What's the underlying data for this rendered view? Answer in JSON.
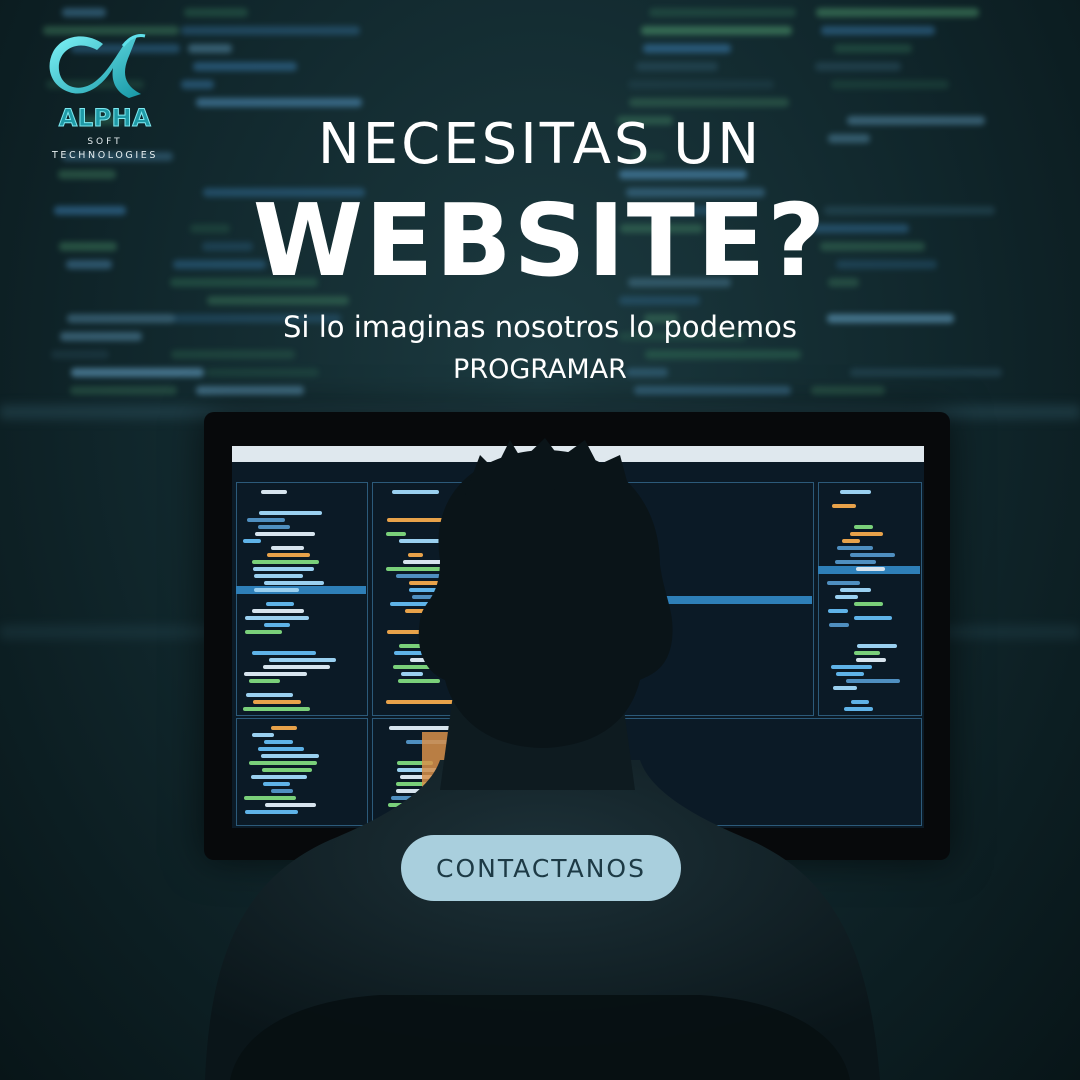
{
  "brand": {
    "name": "ALPHA",
    "tagline_line1": "SOFT",
    "tagline_line2": "TECHNOLOGIES",
    "icon": "alpha-symbol-icon",
    "accent_color": "#22b8c6"
  },
  "headline": {
    "line1": "NECESITAS UN",
    "line2": "WEBSITE?"
  },
  "subheadline": {
    "line1": "Si lo imaginas nosotros lo podemos",
    "line2": "PROGRAMAR"
  },
  "cta": {
    "label": "CONTACTANOS",
    "background_color": "#a9cfdd"
  }
}
